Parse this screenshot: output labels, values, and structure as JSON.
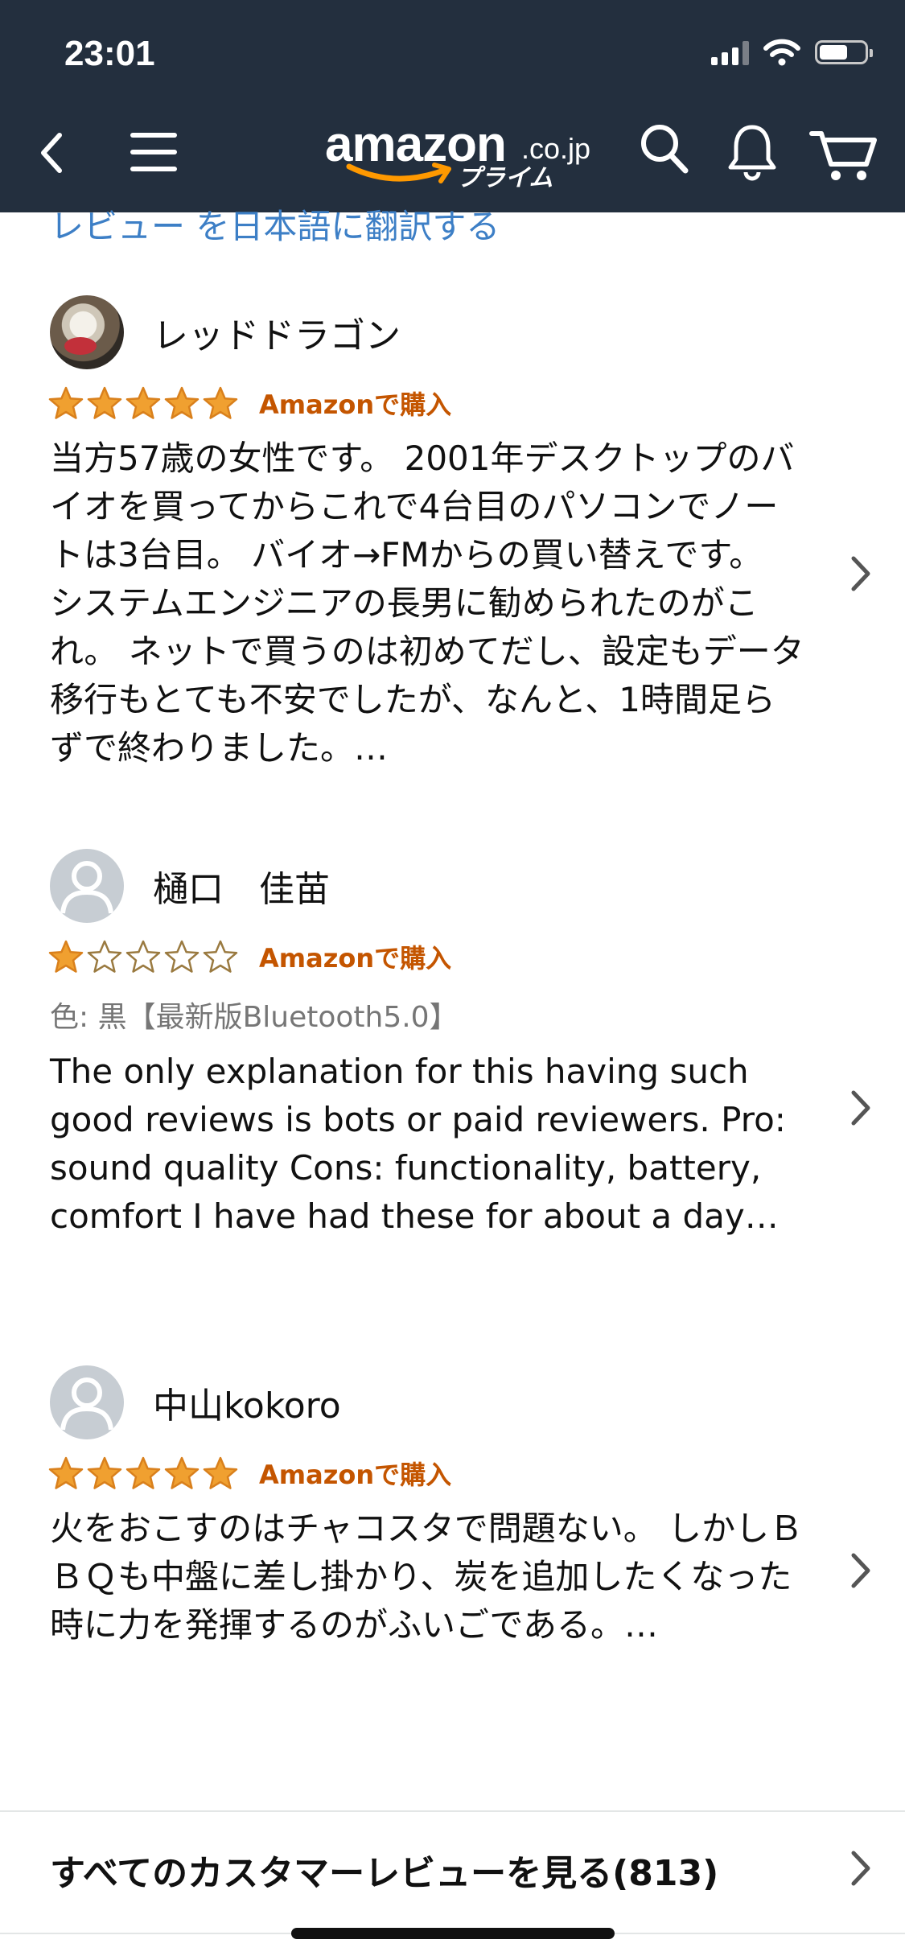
{
  "status_bar": {
    "time": "23:01"
  },
  "header": {
    "logo_word": "amazon",
    "logo_tld": ".co.jp",
    "logo_prime": "プライム"
  },
  "translate_link": "レビュー を日本語に翻訳する",
  "reviews": [
    {
      "name": "レッドドラゴン",
      "rating": 5,
      "verified": "Amazonで購入",
      "variant": "",
      "body": "当方57歳の女性です。 2001年デスクトップのバイオを買ってからこれで4台目のパソコンでノートは3台目。 バイオ→FMからの買い替えです。 システムエンジニアの長男に勧められたのがこれ。 ネットで買うのは初めてだし、設定もデータ移行もとても不安でしたが、なんと、1時間足らずで終わりました。…"
    },
    {
      "name": "樋口　佳苗",
      "rating": 1,
      "verified": "Amazonで購入",
      "variant": "色: 黒【最新版Bluetooth5.0】",
      "body": "The only explanation for this having such good reviews is bots or paid reviewers. Pro: sound quality Cons: functionality, battery, comfort I have had these for about a day…"
    },
    {
      "name": "中山kokoro",
      "rating": 5,
      "verified": "Amazonで購入",
      "variant": "",
      "body": "火をおこすのはチャコスタで問題ない。 しかしＢＢＱも中盤に差し掛かり、炭を追加したくなった時に力を発揮するのがふいごである。…"
    }
  ],
  "all_reviews_label": "すべてのカスタマーレビューを見る(813)",
  "colors": {
    "header_bg": "#232f3e",
    "link": "#3d7fc6",
    "star": "#f0a030",
    "verified": "#c45500"
  }
}
